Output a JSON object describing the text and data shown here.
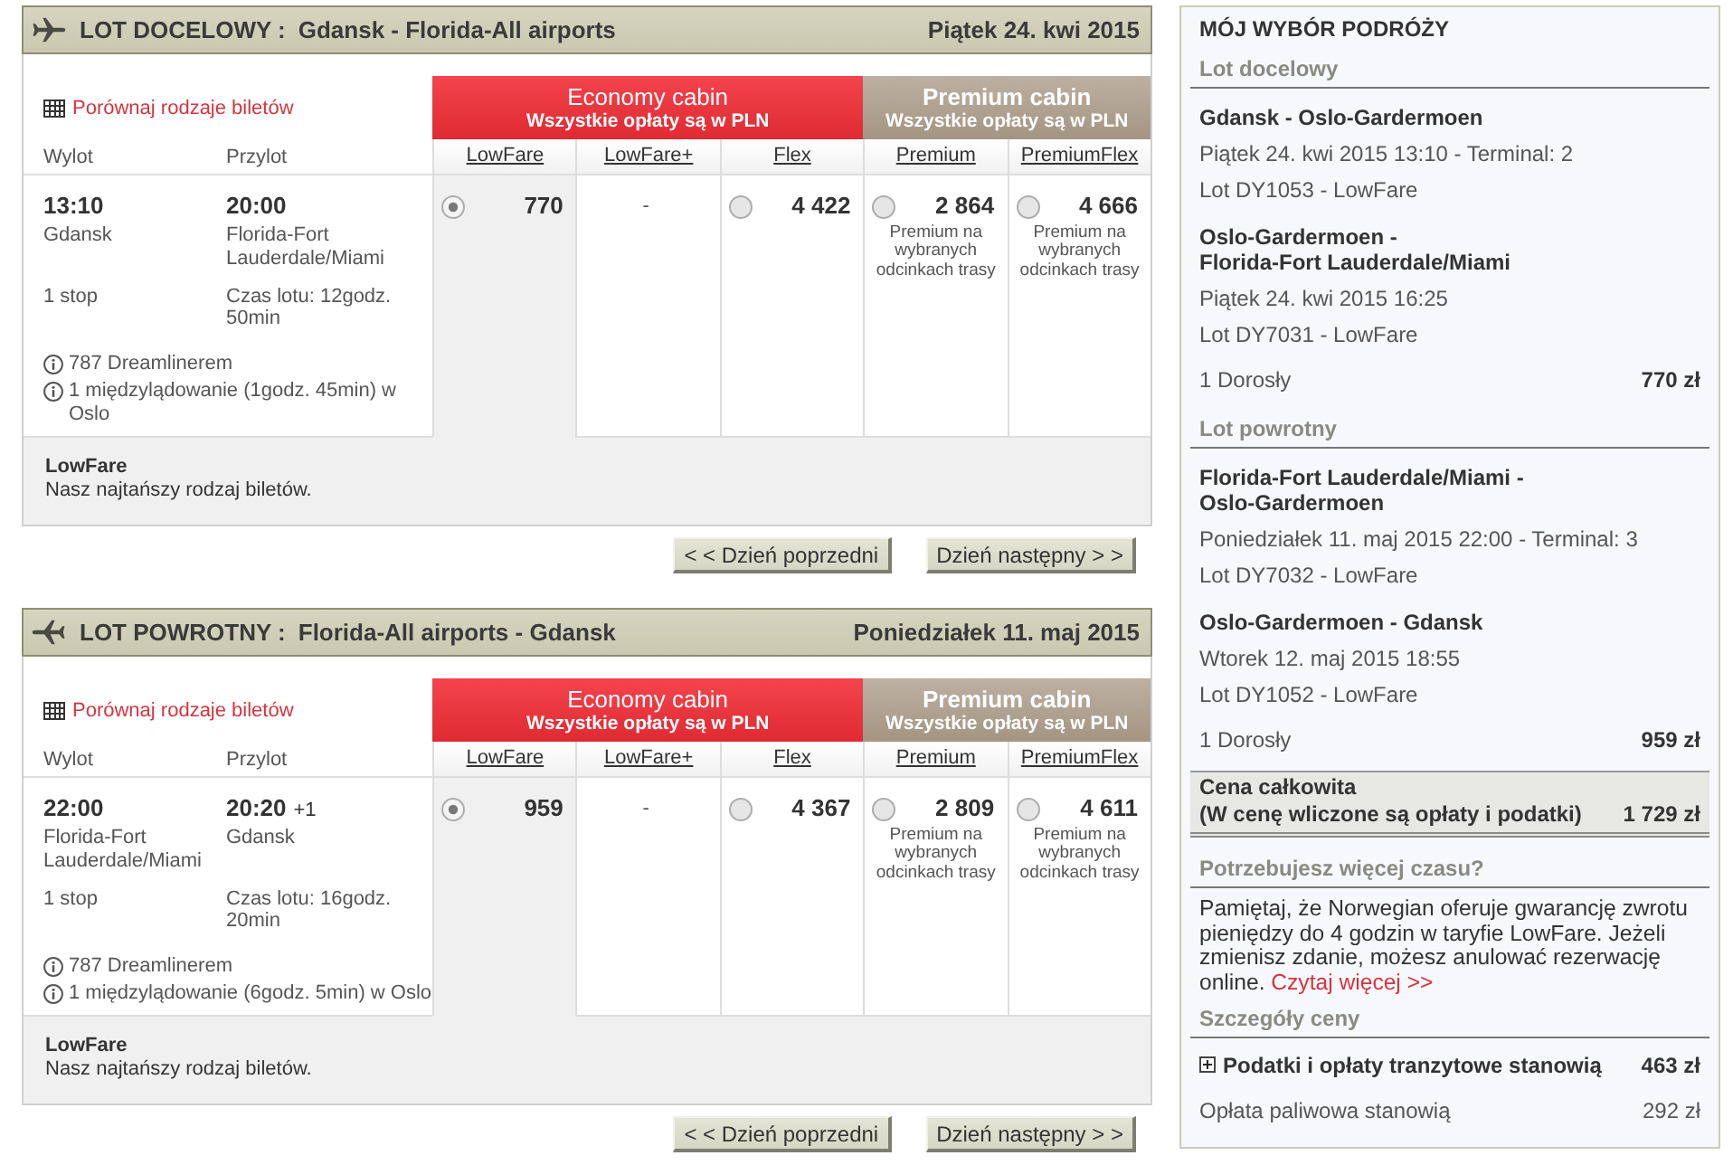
{
  "flights": [
    {
      "kind": "outbound",
      "label": "LOT DOCELOWY :",
      "route": "Gdansk - Florida-All airports",
      "date": "Piątek 24. kwi 2015",
      "compare_link": "Porównaj rodzaje biletów",
      "headers": {
        "departure": "Wylot",
        "arrival": "Przylot"
      },
      "departure": {
        "time": "13:10",
        "place": "Gdansk"
      },
      "arrival": {
        "time": "20:00",
        "place": "Florida-Fort Lauderdale/Miami"
      },
      "stops": "1 stop",
      "duration": "Czas lotu: 12godz. 50min",
      "info": [
        "787 Dreamlinerem",
        "1 międzylądowanie (1godz. 45min) w Oslo"
      ],
      "cabins": [
        {
          "kind": "economy",
          "name": "Economy cabin",
          "note": "Wszystkie opłaty są w PLN",
          "fares": [
            {
              "kind": "radio",
              "label": "LowFare",
              "price": "770",
              "selected": true
            },
            {
              "kind": "dash",
              "label": "LowFare+",
              "price": "-",
              "selected": false
            },
            {
              "kind": "radio",
              "label": "Flex",
              "price": "4 422",
              "selected": false
            }
          ]
        },
        {
          "kind": "premium",
          "name": "Premium cabin",
          "note": "Wszystkie opłaty są w PLN",
          "fares": [
            {
              "kind": "radio",
              "label": "Premium",
              "price": "2 864",
              "selected": false,
              "note": "Premium na wybranych odcinkach trasy"
            },
            {
              "kind": "radio",
              "label": "PremiumFlex",
              "price": "4 666",
              "selected": false,
              "note": "Premium na wybranych odcinkach trasy"
            }
          ]
        }
      ],
      "fare_summary": {
        "name": "LowFare",
        "description": "Nasz najtańszy rodzaj biletów."
      },
      "buttons": [
        "< < Dzień poprzedni",
        "Dzień następny > >"
      ]
    },
    {
      "kind": "return",
      "label": "LOT POWROTNY :",
      "route": "Florida-All airports - Gdansk",
      "date": "Poniedziałek 11. maj 2015",
      "compare_link": "Porównaj rodzaje biletów",
      "headers": {
        "departure": "Wylot",
        "arrival": "Przylot"
      },
      "departure": {
        "time": "22:00",
        "place": "Florida-Fort Lauderdale/Miami"
      },
      "arrival": {
        "time": "20:20",
        "day_offset": "+1",
        "place": "Gdansk"
      },
      "stops": "1 stop",
      "duration": "Czas lotu: 16godz. 20min",
      "info": [
        "787 Dreamlinerem",
        "1 międzylądowanie (6godz. 5min) w Oslo"
      ],
      "cabins": [
        {
          "kind": "economy",
          "name": "Economy cabin",
          "note": "Wszystkie opłaty są w PLN",
          "fares": [
            {
              "kind": "radio",
              "label": "LowFare",
              "price": "959",
              "selected": true
            },
            {
              "kind": "dash",
              "label": "LowFare+",
              "price": "-",
              "selected": false
            },
            {
              "kind": "radio",
              "label": "Flex",
              "price": "4 367",
              "selected": false
            }
          ]
        },
        {
          "kind": "premium",
          "name": "Premium cabin",
          "note": "Wszystkie opłaty są w PLN",
          "fares": [
            {
              "kind": "radio",
              "label": "Premium",
              "price": "2 809",
              "selected": false,
              "note": "Premium na wybranych odcinkach trasy"
            },
            {
              "kind": "radio",
              "label": "PremiumFlex",
              "price": "4 611",
              "selected": false,
              "note": "Premium na wybranych odcinkach trasy"
            }
          ]
        }
      ],
      "fare_summary": {
        "name": "LowFare",
        "description": "Nasz najtańszy rodzaj biletów."
      },
      "buttons": [
        "< < Dzień poprzedni",
        "Dzień następny > >"
      ]
    }
  ],
  "summary": {
    "title": "MÓJ WYBÓR PODRÓŻY",
    "trips": [
      {
        "heading": "Lot docelowy",
        "segments": [
          {
            "route": "Gdansk - Oslo-Gardermoen",
            "departure": "Piątek 24. kwi 2015 13:10 - Terminal: 2",
            "flight": "Lot DY1053 - LowFare"
          },
          {
            "route": "Oslo-Gardermoen -\nFlorida-Fort Lauderdale/Miami",
            "departure": "Piątek 24. kwi 2015 16:25",
            "flight": "Lot DY7031 - LowFare"
          }
        ],
        "passengers": "1 Dorosły",
        "price": "770 zł"
      },
      {
        "heading": "Lot powrotny",
        "segments": [
          {
            "route": "Florida-Fort Lauderdale/Miami -\nOslo-Gardermoen",
            "departure": "Poniedziałek 11. maj 2015 22:00 - Terminal: 3",
            "flight": "Lot DY7032 - LowFare"
          },
          {
            "route": "Oslo-Gardermoen - Gdansk",
            "departure": "Wtorek 12. maj 2015 18:55",
            "flight": "Lot DY1052 - LowFare"
          }
        ],
        "passengers": "1 Dorosły",
        "price": "959 zł"
      }
    ],
    "total": {
      "label": "Cena całkowita",
      "note": "(W cenę wliczone są opłaty i podatki)",
      "price": "1 729 zł"
    },
    "more_time": {
      "heading": "Potrzebujesz więcej czasu?",
      "text": "Pamiętaj, że Norwegian oferuje gwarancję zwrotu pieniędzy do 4 godzin w taryfie LowFare. Jeżeli zmienisz zdanie, możesz anulować rezerwację online.",
      "link": "Czytaj więcej >>"
    },
    "price_details": {
      "heading": "Szczegóły ceny",
      "items": [
        {
          "kind": "expandable",
          "label": "Podatki i opłaty tranzytowe stanowią",
          "amount": "463 zł",
          "expanded": false
        },
        {
          "kind": "plain",
          "label": "Opłata paliwowa stanowią",
          "amount": "292 zł"
        }
      ]
    }
  }
}
